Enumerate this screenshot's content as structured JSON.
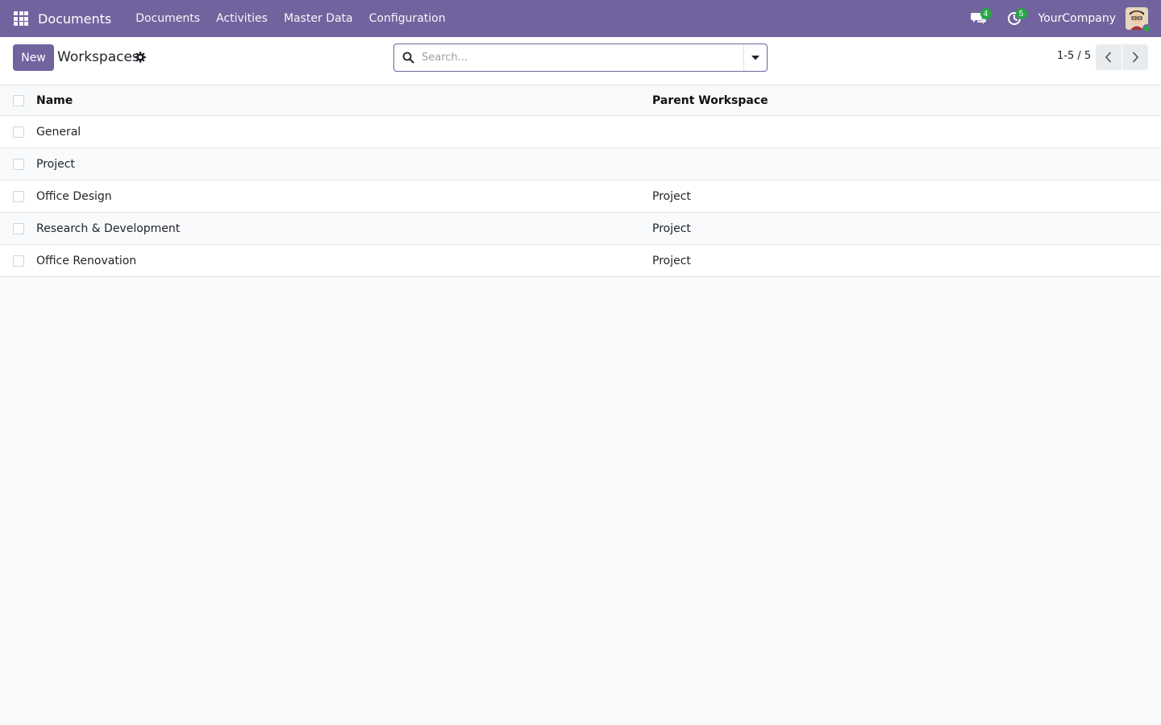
{
  "navbar": {
    "brand": "Documents",
    "menu": [
      "Documents",
      "Activities",
      "Master Data",
      "Configuration"
    ],
    "messages_count": "4",
    "activities_count": "5",
    "company": "YourCompany",
    "icons": [
      "apps-grid-icon",
      "chat-icon",
      "clock-icon",
      "avatar"
    ]
  },
  "control_panel": {
    "new_label": "New",
    "title": "Workspaces",
    "search_placeholder": "Search...",
    "search_value": "",
    "pager": "1-5 / 5"
  },
  "table": {
    "headers": {
      "name": "Name",
      "parent": "Parent Workspace"
    },
    "rows": [
      {
        "name": "General",
        "parent": ""
      },
      {
        "name": "Project",
        "parent": ""
      },
      {
        "name": "Office Design",
        "parent": "Project"
      },
      {
        "name": "Research & Development",
        "parent": "Project"
      },
      {
        "name": "Office Renovation",
        "parent": "Project"
      }
    ]
  },
  "colors": {
    "brand": "#71639e",
    "badge": "#28a745"
  }
}
